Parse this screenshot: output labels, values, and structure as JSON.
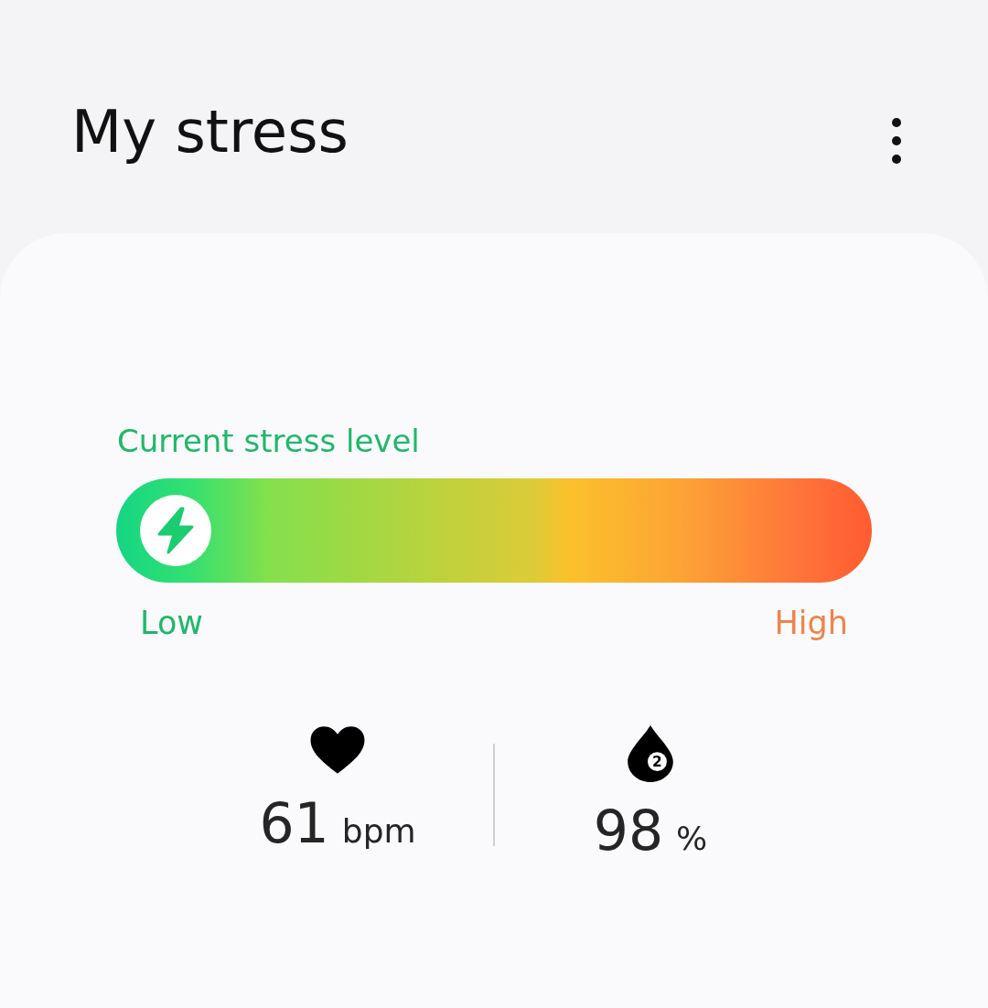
{
  "header": {
    "title": "My stress"
  },
  "stress": {
    "label": "Current stress level",
    "level": 0,
    "low_label": "Low",
    "high_label": "High"
  },
  "metrics": [
    {
      "kind": "heart",
      "value": "61",
      "unit": "bpm"
    },
    {
      "kind": "oxygen",
      "value": "98",
      "unit": "%",
      "icon_digit": "2"
    }
  ]
}
